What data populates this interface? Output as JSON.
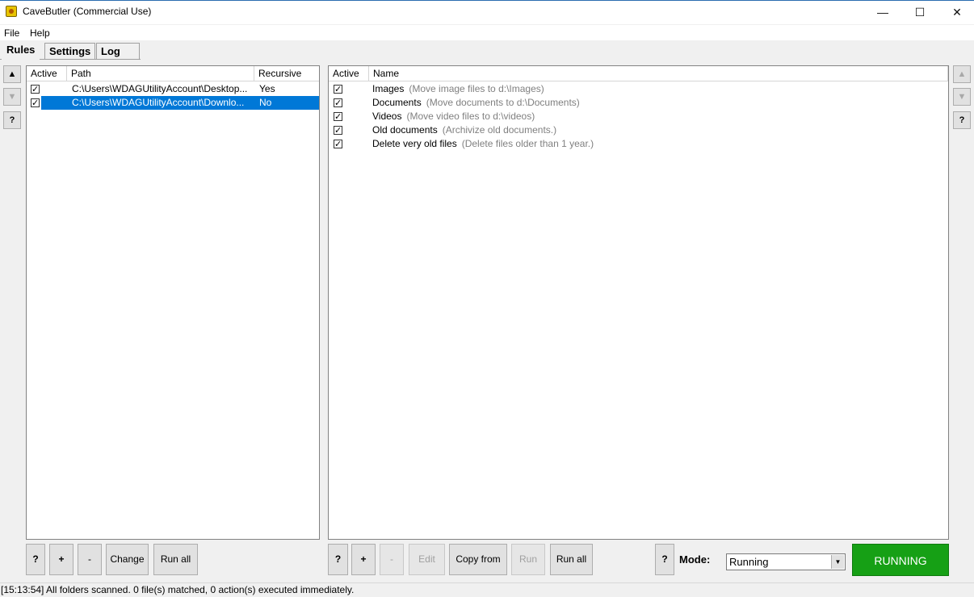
{
  "window": {
    "title": "CaveButler (Commercial Use)",
    "minimize": "—",
    "maximize": "☐",
    "close": "✕"
  },
  "menu": {
    "file": "File",
    "help": "Help"
  },
  "tabs": [
    {
      "label": "Rules",
      "active": true
    },
    {
      "label": "Settings",
      "active": false
    },
    {
      "label": "Log",
      "active": false
    }
  ],
  "left_side_buttons": {
    "up": "▲",
    "down": "▼",
    "help": "?"
  },
  "right_side_buttons": {
    "up": "▲",
    "down": "▼",
    "help": "?"
  },
  "folders": {
    "columns": {
      "active": "Active",
      "path": "Path",
      "recursive": "Recursive"
    },
    "rows": [
      {
        "active": true,
        "path": "C:\\Users\\WDAGUtilityAccount\\Desktop...",
        "recursive": "Yes",
        "selected": false
      },
      {
        "active": true,
        "path": "C:\\Users\\WDAGUtilityAccount\\Downlo...",
        "recursive": "No",
        "selected": true
      }
    ],
    "buttons": {
      "help": "?",
      "add": "+",
      "remove": "-",
      "change": "Change",
      "run_all": "Run all"
    }
  },
  "rules": {
    "columns": {
      "active": "Active",
      "name": "Name"
    },
    "rows": [
      {
        "active": true,
        "name": "Images",
        "desc": "(Move image files to d:\\Images)"
      },
      {
        "active": true,
        "name": "Documents",
        "desc": "(Move documents to d:\\Documents)"
      },
      {
        "active": true,
        "name": "Videos",
        "desc": "(Move video files to d:\\videos)"
      },
      {
        "active": true,
        "name": "Old documents",
        "desc": "(Archivize old documents.)"
      },
      {
        "active": true,
        "name": "Delete very old files",
        "desc": "(Delete files older than 1 year.)"
      }
    ],
    "buttons": {
      "help": "?",
      "add": "+",
      "remove": "-",
      "edit": "Edit",
      "copy_from": "Copy from",
      "run": "Run",
      "run_all": "Run all"
    }
  },
  "mode": {
    "help": "?",
    "label": "Mode:",
    "value": "Running",
    "status_button": "RUNNING",
    "status_color": "#16a015"
  },
  "status_bar": "[15:13:54] All folders scanned. 0 file(s) matched, 0 action(s) executed immediately."
}
